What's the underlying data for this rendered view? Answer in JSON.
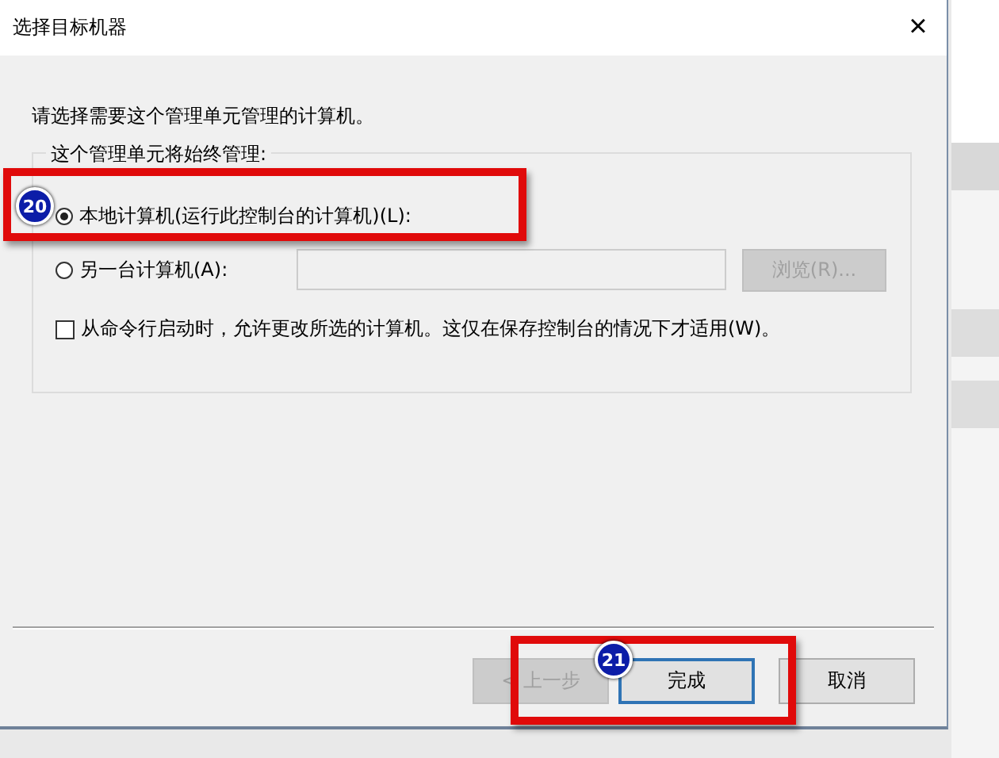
{
  "window": {
    "title": "选择目标机器",
    "close": "×"
  },
  "instruction": "请选择需要这个管理单元管理的计算机。",
  "group": {
    "legend": "这个管理单元将始终管理:",
    "options": [
      {
        "label": "本地计算机(运行此控制台的计算机)(L):",
        "selected": true
      },
      {
        "label": "另一台计算机(A):",
        "selected": false
      }
    ],
    "computer_field": {
      "disabled": true
    },
    "browse_button": {
      "label": "浏览(R)...",
      "disabled": true
    },
    "allow_change": {
      "label": "从命令行启动时，允许更改所选的计算机。这仅在保存控制台的情况下才适用(W)。",
      "checked": false
    }
  },
  "buttons": [
    {
      "label": "< 上一步",
      "disabled": true,
      "focused": false
    },
    {
      "label": "完成",
      "disabled": false,
      "focused": true
    },
    {
      "label": "取消",
      "disabled": false,
      "focused": false
    }
  ],
  "annotations": [
    {
      "number": "20"
    },
    {
      "number": "21"
    }
  ]
}
